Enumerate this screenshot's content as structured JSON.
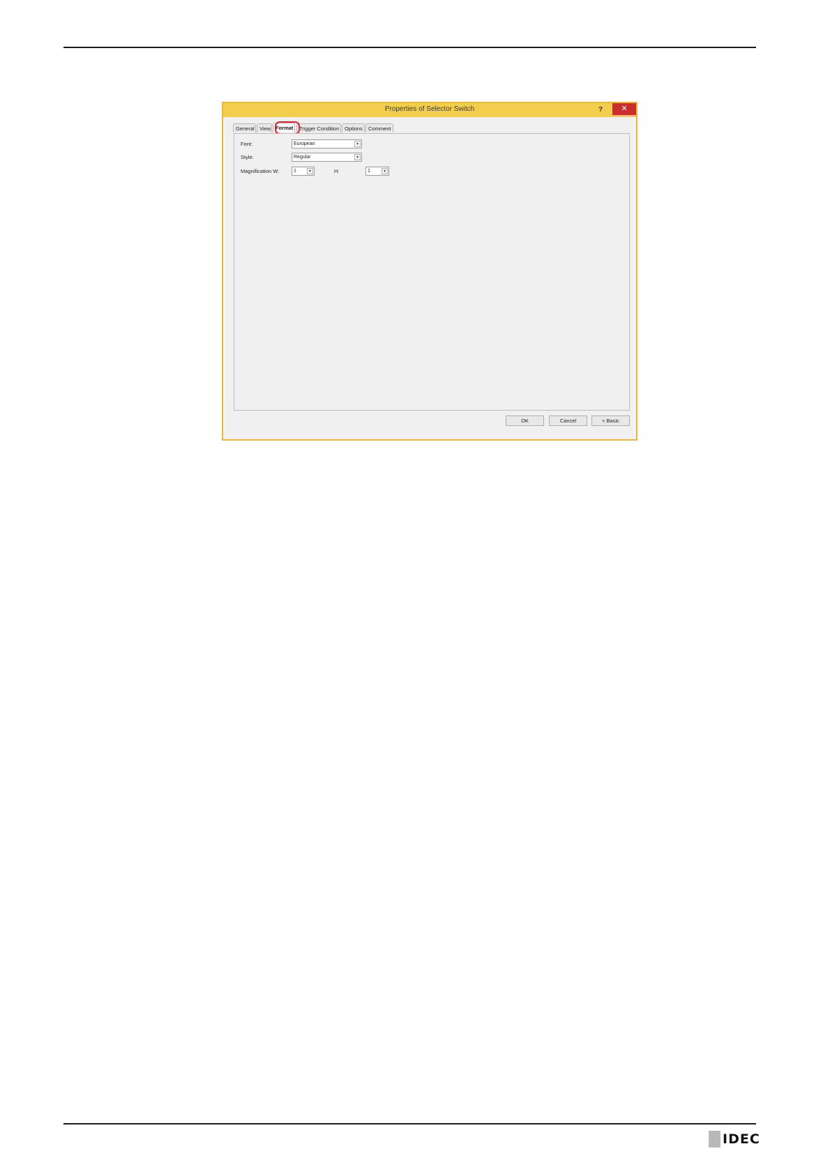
{
  "dialog": {
    "title": "Properties of Selector Switch",
    "help_label": "?",
    "close_label": "✕",
    "tabs": [
      {
        "label": "General"
      },
      {
        "label": "View"
      },
      {
        "label": "Format",
        "active": true
      },
      {
        "label": "Trigger Condition"
      },
      {
        "label": "Options"
      },
      {
        "label": "Comment"
      }
    ],
    "format": {
      "font_label": "Font:",
      "font_value": "European",
      "style_label": "Style:",
      "style_value": "Regular",
      "magnification_w_label": "Magnification W:",
      "magnification_w_value": "1",
      "magnification_h_label": "H:",
      "magnification_h_value": "1"
    },
    "buttons": {
      "ok": "OK",
      "cancel": "Cancel",
      "basic": "< Basic"
    }
  },
  "footer": {
    "logo_text": "IDEC"
  }
}
